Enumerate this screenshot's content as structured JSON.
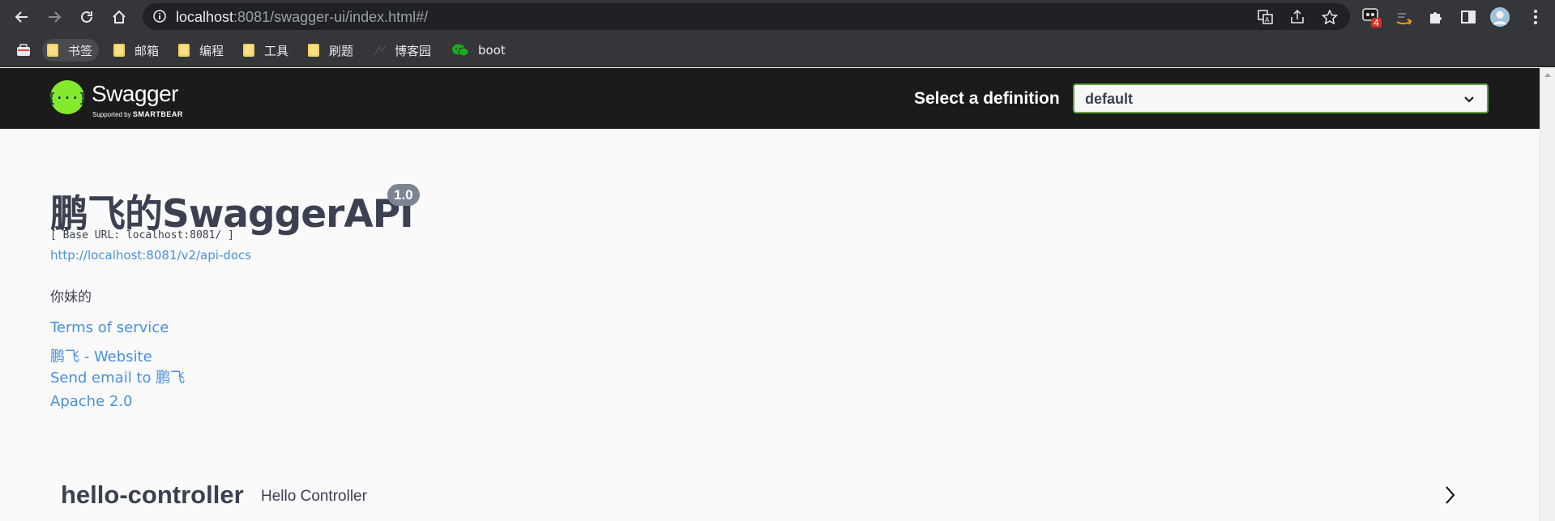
{
  "browser": {
    "url_host": "localhost",
    "url_rest": ":8081/swagger-ui/index.html#/",
    "extension_badge": "4",
    "bookmarks": [
      {
        "label": "书签",
        "type": "folder"
      },
      {
        "label": "邮箱",
        "type": "folder"
      },
      {
        "label": "编程",
        "type": "folder"
      },
      {
        "label": "工具",
        "type": "folder"
      },
      {
        "label": "刷题",
        "type": "folder"
      },
      {
        "label": "博客园",
        "type": "site"
      },
      {
        "label": "boot",
        "type": "site"
      }
    ]
  },
  "swagger_header": {
    "logo_symbol": "{···}",
    "logo_text": "Swagger",
    "logo_sub_prefix": "Supported by",
    "logo_sub_brand": "SMARTBEAR",
    "definition_label": "Select a definition",
    "definition_value": "default"
  },
  "info": {
    "title": "鹏飞的SwaggerAPI",
    "version": "1.0",
    "base_url": "[ Base URL: localhost:8081/ ]",
    "api_docs_link": "http://localhost:8081/v2/api-docs",
    "description": "你妹的",
    "terms_of_service": "Terms of service",
    "website_link": "鹏飞 - Website",
    "email_link": "Send email to 鹏飞",
    "license_link": "Apache 2.0"
  },
  "controllers": [
    {
      "name": "hello-controller",
      "description": "Hello Controller"
    }
  ],
  "colors": {
    "swagger_green": "#85ea2d",
    "link_blue": "#4990e2",
    "title_text": "#3b4151",
    "topbar_bg": "#1b1b1b"
  }
}
